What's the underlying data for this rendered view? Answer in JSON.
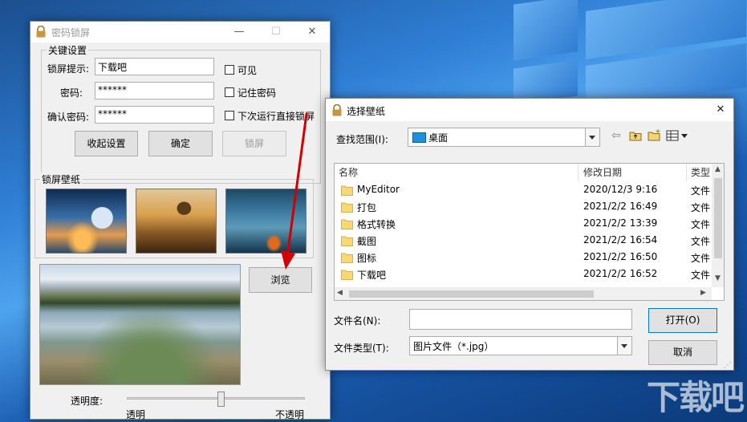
{
  "colors": {
    "accent": "#0078d7",
    "desktop": "#2f7fd6",
    "arrow": "#d40000"
  },
  "lockWindow": {
    "title": "密码锁屏",
    "controls": {
      "minimize": "—",
      "maximize": "☐",
      "close": "✕"
    },
    "keySettings": {
      "title": "关键设置",
      "hintLabel": "锁屏提示:",
      "hintValue": "下载吧",
      "passwordLabel": "密码:",
      "passwordValue": "******",
      "confirmLabel": "确认密码:",
      "confirmValue": "******",
      "visibleLabel": "可见",
      "rememberLabel": "记住密码",
      "lockOnNextRunLabel": "下次运行直接锁屏",
      "collapseButton": "收起设置",
      "okButton": "确定",
      "lockButton": "锁屏"
    },
    "wallpaper": {
      "title": "锁屏壁纸",
      "browseButton": "浏览"
    },
    "opacity": {
      "label": "透明度:",
      "minLabel": "透明",
      "maxLabel": "不透明",
      "value": 0.53
    }
  },
  "fileDialog": {
    "title": "选择壁纸",
    "closeIcon": "✕",
    "lookInLabel": "查找范围(I):",
    "lookInValue": "桌面",
    "columns": {
      "name": "名称",
      "date": "修改日期",
      "type": "类型"
    },
    "files": [
      {
        "name": "MyEditor",
        "date": "2020/12/3 9:16",
        "type": "文件"
      },
      {
        "name": "打包",
        "date": "2021/2/2 16:49",
        "type": "文件"
      },
      {
        "name": "格式转换",
        "date": "2021/2/2 13:39",
        "type": "文件"
      },
      {
        "name": "截图",
        "date": "2021/2/2 16:54",
        "type": "文件"
      },
      {
        "name": "图标",
        "date": "2021/2/2 16:50",
        "type": "文件"
      },
      {
        "name": "下载吧",
        "date": "2021/2/2 16:52",
        "type": "文件"
      }
    ],
    "fileNameLabel": "文件名(N):",
    "fileNameValue": "",
    "fileTypeLabel": "文件类型(T):",
    "fileTypeValue": "图片文件（*.jpg）",
    "openButton": "打开(O)",
    "cancelButton": "取消"
  },
  "watermark": "下载吧",
  "icons": [
    "lock-icon",
    "back-arrow-icon",
    "up-folder-icon",
    "new-folder-icon",
    "view-menu-icon",
    "folder-icon",
    "desktop-icon"
  ]
}
